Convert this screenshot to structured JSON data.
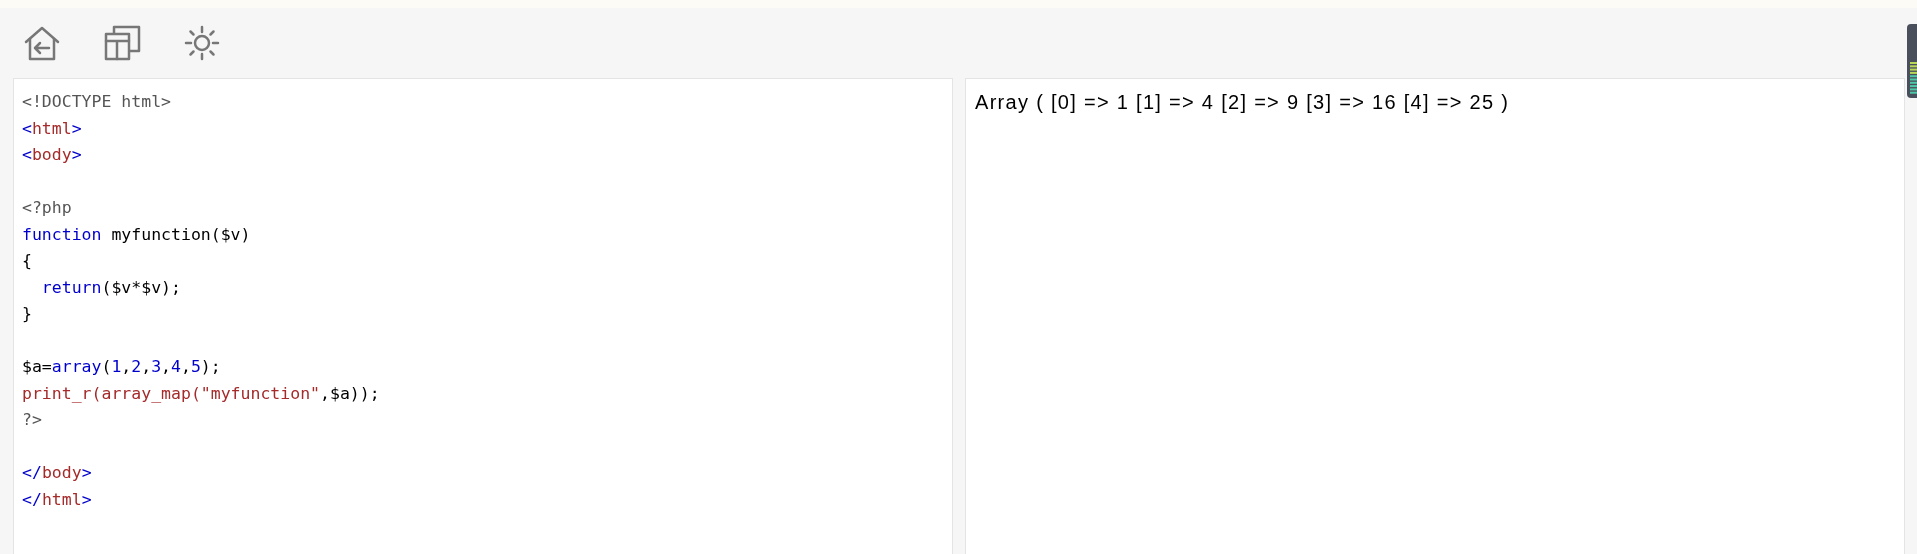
{
  "toolbar": {
    "buttons": [
      {
        "kind": "home"
      },
      {
        "kind": "windows"
      },
      {
        "kind": "theme"
      }
    ]
  },
  "editor": {
    "lines": [
      {
        "kind": "code",
        "tokens": [
          {
            "kind": "meta",
            "text": "<!DOCTYPE html>"
          }
        ]
      },
      {
        "kind": "code",
        "tokens": [
          {
            "kind": "bracket",
            "text": "<"
          },
          {
            "kind": "tag",
            "text": "html"
          },
          {
            "kind": "bracket",
            "text": ">"
          }
        ]
      },
      {
        "kind": "code",
        "tokens": [
          {
            "kind": "bracket",
            "text": "<"
          },
          {
            "kind": "tag",
            "text": "body"
          },
          {
            "kind": "bracket",
            "text": ">"
          }
        ]
      },
      {
        "kind": "blank"
      },
      {
        "kind": "code",
        "tokens": [
          {
            "kind": "meta",
            "text": "<?php"
          }
        ]
      },
      {
        "kind": "code",
        "tokens": [
          {
            "kind": "keyword",
            "text": "function"
          },
          {
            "kind": "plain",
            "text": " myfunction($v)"
          }
        ]
      },
      {
        "kind": "code",
        "tokens": [
          {
            "kind": "plain",
            "text": "{"
          }
        ]
      },
      {
        "kind": "code",
        "indented": true,
        "tokens": [
          {
            "kind": "keyword",
            "text": "return"
          },
          {
            "kind": "plain",
            "text": "($v*$v);"
          }
        ]
      },
      {
        "kind": "code",
        "tokens": [
          {
            "kind": "plain",
            "text": "}"
          }
        ]
      },
      {
        "kind": "blank"
      },
      {
        "kind": "code",
        "tokens": [
          {
            "kind": "plain",
            "text": "$a="
          },
          {
            "kind": "keyword",
            "text": "array"
          },
          {
            "kind": "plain",
            "text": "("
          },
          {
            "kind": "number",
            "text": "1"
          },
          {
            "kind": "plain",
            "text": ","
          },
          {
            "kind": "number",
            "text": "2"
          },
          {
            "kind": "plain",
            "text": ","
          },
          {
            "kind": "number",
            "text": "3"
          },
          {
            "kind": "plain",
            "text": ","
          },
          {
            "kind": "number",
            "text": "4"
          },
          {
            "kind": "plain",
            "text": ","
          },
          {
            "kind": "number",
            "text": "5"
          },
          {
            "kind": "plain",
            "text": ");"
          }
        ]
      },
      {
        "kind": "code",
        "tokens": [
          {
            "kind": "builtin",
            "text": "print_r(array_map("
          },
          {
            "kind": "string",
            "text": "\"myfunction\""
          },
          {
            "kind": "plain",
            "text": ",$a));"
          }
        ]
      },
      {
        "kind": "code",
        "tokens": [
          {
            "kind": "meta",
            "text": "?>"
          }
        ]
      },
      {
        "kind": "blank"
      },
      {
        "kind": "code",
        "tokens": [
          {
            "kind": "bracket",
            "text": "</"
          },
          {
            "kind": "tag",
            "text": "body"
          },
          {
            "kind": "bracket",
            "text": ">"
          }
        ]
      },
      {
        "kind": "code",
        "tokens": [
          {
            "kind": "bracket",
            "text": "</"
          },
          {
            "kind": "tag",
            "text": "html"
          },
          {
            "kind": "bracket",
            "text": ">"
          }
        ]
      }
    ]
  },
  "output": {
    "text": "Array ( [0] => 1 [1] => 4 [2] => 9 [3] => 16 [4] => 25 )"
  }
}
